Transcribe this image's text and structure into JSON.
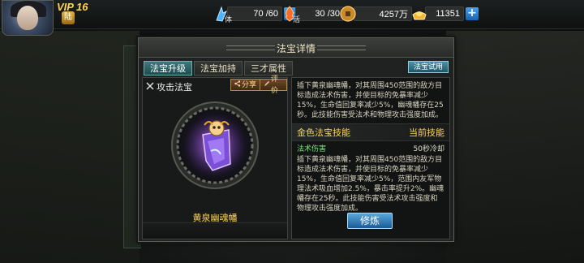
{
  "hud": {
    "vip_prefix": "VIP",
    "vip_level": "16",
    "race_badge": "陆",
    "stamina": {
      "icon": "stamina-icon",
      "label": "体",
      "value": "70 /60"
    },
    "energy": {
      "icon": "energy-icon",
      "label": "活",
      "value": "30 /30"
    },
    "copper": {
      "icon": "copper-coin-icon",
      "value": "4257万"
    },
    "ingot": {
      "icon": "gold-ingot-icon",
      "value": "11351"
    },
    "plus_symbol": "+"
  },
  "dialog": {
    "title": "法宝详情",
    "tabs": [
      {
        "label": "法宝升级",
        "active": true
      },
      {
        "label": "法宝加持",
        "active": false
      },
      {
        "label": "三才属性",
        "active": false
      }
    ],
    "weapon_type": "攻击法宝",
    "share_label": "分享",
    "rate_label": "评价",
    "item_name": "黄泉幽魂幡",
    "try_label": "法宝试用",
    "description": "插下黄泉幽魂幡，对其周围450范围的敌方目标造成法术伤害，并使目标的免暴率减少15%，生命值回复率减少5%，幽魂幡存在25秒。此技能伤害受法术和物理攻击强度加成。",
    "skill": {
      "title": "金色法宝技能",
      "status": "当前技能",
      "type": "法术伤害",
      "cooldown": "50秒冷却",
      "description": "插下黄泉幽魂幡，对其周围450范围的敌方目标造成法术伤害，并使目标的免暴率减少15%，生命值回复率减少5%，范围内友军物理法术吸血增加2.5%，暴击率提升2%。幽魂幡存在25秒。此技能伤害受法术攻击强度和物理攻击强度加成。"
    },
    "cultivate_label": "修炼"
  },
  "colors": {
    "accent_gold": "#ffd454",
    "tab_active": "#3d7a7e",
    "skill_type_green": "#7ee37e",
    "button_blue": "#1b5a96"
  }
}
